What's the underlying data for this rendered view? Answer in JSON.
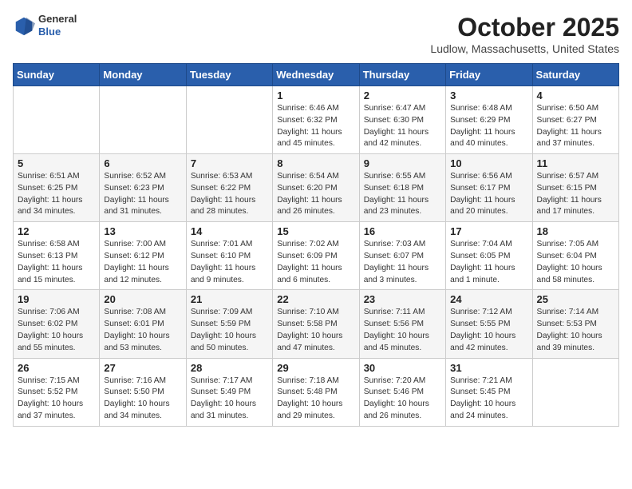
{
  "header": {
    "logo_general": "General",
    "logo_blue": "Blue",
    "month_title": "October 2025",
    "location": "Ludlow, Massachusetts, United States"
  },
  "days_of_week": [
    "Sunday",
    "Monday",
    "Tuesday",
    "Wednesday",
    "Thursday",
    "Friday",
    "Saturday"
  ],
  "weeks": [
    [
      {
        "day": "",
        "info": ""
      },
      {
        "day": "",
        "info": ""
      },
      {
        "day": "",
        "info": ""
      },
      {
        "day": "1",
        "info": "Sunrise: 6:46 AM\nSunset: 6:32 PM\nDaylight: 11 hours\nand 45 minutes."
      },
      {
        "day": "2",
        "info": "Sunrise: 6:47 AM\nSunset: 6:30 PM\nDaylight: 11 hours\nand 42 minutes."
      },
      {
        "day": "3",
        "info": "Sunrise: 6:48 AM\nSunset: 6:29 PM\nDaylight: 11 hours\nand 40 minutes."
      },
      {
        "day": "4",
        "info": "Sunrise: 6:50 AM\nSunset: 6:27 PM\nDaylight: 11 hours\nand 37 minutes."
      }
    ],
    [
      {
        "day": "5",
        "info": "Sunrise: 6:51 AM\nSunset: 6:25 PM\nDaylight: 11 hours\nand 34 minutes."
      },
      {
        "day": "6",
        "info": "Sunrise: 6:52 AM\nSunset: 6:23 PM\nDaylight: 11 hours\nand 31 minutes."
      },
      {
        "day": "7",
        "info": "Sunrise: 6:53 AM\nSunset: 6:22 PM\nDaylight: 11 hours\nand 28 minutes."
      },
      {
        "day": "8",
        "info": "Sunrise: 6:54 AM\nSunset: 6:20 PM\nDaylight: 11 hours\nand 26 minutes."
      },
      {
        "day": "9",
        "info": "Sunrise: 6:55 AM\nSunset: 6:18 PM\nDaylight: 11 hours\nand 23 minutes."
      },
      {
        "day": "10",
        "info": "Sunrise: 6:56 AM\nSunset: 6:17 PM\nDaylight: 11 hours\nand 20 minutes."
      },
      {
        "day": "11",
        "info": "Sunrise: 6:57 AM\nSunset: 6:15 PM\nDaylight: 11 hours\nand 17 minutes."
      }
    ],
    [
      {
        "day": "12",
        "info": "Sunrise: 6:58 AM\nSunset: 6:13 PM\nDaylight: 11 hours\nand 15 minutes."
      },
      {
        "day": "13",
        "info": "Sunrise: 7:00 AM\nSunset: 6:12 PM\nDaylight: 11 hours\nand 12 minutes."
      },
      {
        "day": "14",
        "info": "Sunrise: 7:01 AM\nSunset: 6:10 PM\nDaylight: 11 hours\nand 9 minutes."
      },
      {
        "day": "15",
        "info": "Sunrise: 7:02 AM\nSunset: 6:09 PM\nDaylight: 11 hours\nand 6 minutes."
      },
      {
        "day": "16",
        "info": "Sunrise: 7:03 AM\nSunset: 6:07 PM\nDaylight: 11 hours\nand 3 minutes."
      },
      {
        "day": "17",
        "info": "Sunrise: 7:04 AM\nSunset: 6:05 PM\nDaylight: 11 hours\nand 1 minute."
      },
      {
        "day": "18",
        "info": "Sunrise: 7:05 AM\nSunset: 6:04 PM\nDaylight: 10 hours\nand 58 minutes."
      }
    ],
    [
      {
        "day": "19",
        "info": "Sunrise: 7:06 AM\nSunset: 6:02 PM\nDaylight: 10 hours\nand 55 minutes."
      },
      {
        "day": "20",
        "info": "Sunrise: 7:08 AM\nSunset: 6:01 PM\nDaylight: 10 hours\nand 53 minutes."
      },
      {
        "day": "21",
        "info": "Sunrise: 7:09 AM\nSunset: 5:59 PM\nDaylight: 10 hours\nand 50 minutes."
      },
      {
        "day": "22",
        "info": "Sunrise: 7:10 AM\nSunset: 5:58 PM\nDaylight: 10 hours\nand 47 minutes."
      },
      {
        "day": "23",
        "info": "Sunrise: 7:11 AM\nSunset: 5:56 PM\nDaylight: 10 hours\nand 45 minutes."
      },
      {
        "day": "24",
        "info": "Sunrise: 7:12 AM\nSunset: 5:55 PM\nDaylight: 10 hours\nand 42 minutes."
      },
      {
        "day": "25",
        "info": "Sunrise: 7:14 AM\nSunset: 5:53 PM\nDaylight: 10 hours\nand 39 minutes."
      }
    ],
    [
      {
        "day": "26",
        "info": "Sunrise: 7:15 AM\nSunset: 5:52 PM\nDaylight: 10 hours\nand 37 minutes."
      },
      {
        "day": "27",
        "info": "Sunrise: 7:16 AM\nSunset: 5:50 PM\nDaylight: 10 hours\nand 34 minutes."
      },
      {
        "day": "28",
        "info": "Sunrise: 7:17 AM\nSunset: 5:49 PM\nDaylight: 10 hours\nand 31 minutes."
      },
      {
        "day": "29",
        "info": "Sunrise: 7:18 AM\nSunset: 5:48 PM\nDaylight: 10 hours\nand 29 minutes."
      },
      {
        "day": "30",
        "info": "Sunrise: 7:20 AM\nSunset: 5:46 PM\nDaylight: 10 hours\nand 26 minutes."
      },
      {
        "day": "31",
        "info": "Sunrise: 7:21 AM\nSunset: 5:45 PM\nDaylight: 10 hours\nand 24 minutes."
      },
      {
        "day": "",
        "info": ""
      }
    ]
  ]
}
